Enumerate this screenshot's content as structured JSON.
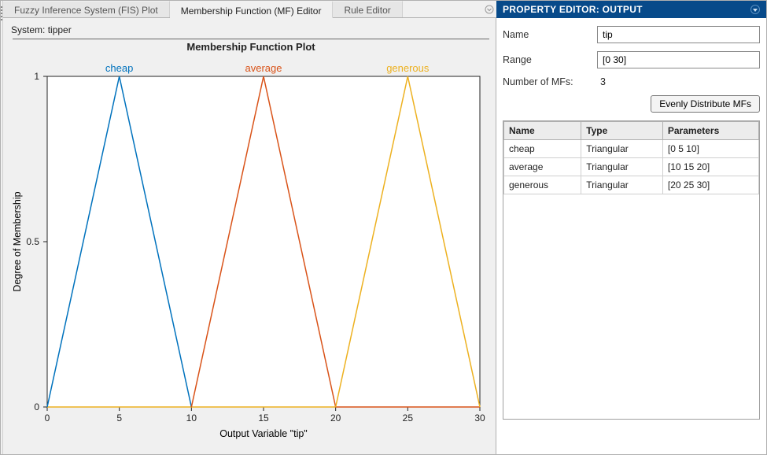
{
  "tabs": [
    {
      "label": "Fuzzy Inference System (FIS) Plot",
      "active": false
    },
    {
      "label": "Membership Function (MF) Editor",
      "active": true
    },
    {
      "label": "Rule Editor",
      "active": false
    }
  ],
  "system_label": "System:",
  "system_name": "tipper",
  "plot_title": "Membership Function Plot",
  "xlabel": "Output Variable \"tip\"",
  "ylabel": "Degree of Membership",
  "mf_labels": {
    "cheap": "cheap",
    "average": "average",
    "generous": "generous"
  },
  "x_ticks": [
    "0",
    "5",
    "10",
    "15",
    "20",
    "25",
    "30"
  ],
  "y_ticks": [
    "0",
    "0.5",
    "1"
  ],
  "colors": {
    "cheap": "#0072bd",
    "average": "#d95319",
    "generous": "#edb120"
  },
  "property_editor": {
    "title": "PROPERTY EDITOR: OUTPUT",
    "name_label": "Name",
    "name_value": "tip",
    "range_label": "Range",
    "range_value": "[0 30]",
    "num_mfs_label": "Number of MFs:",
    "num_mfs_value": "3",
    "distribute_btn": "Evenly Distribute MFs",
    "table_headers": {
      "name": "Name",
      "type": "Type",
      "params": "Parameters"
    },
    "rows": [
      {
        "name": "cheap",
        "type": "Triangular",
        "params": "[0 5 10]"
      },
      {
        "name": "average",
        "type": "Triangular",
        "params": "[10 15 20]"
      },
      {
        "name": "generous",
        "type": "Triangular",
        "params": "[20 25 30]"
      }
    ]
  },
  "chart_data": {
    "type": "line",
    "title": "Membership Function Plot",
    "xlabel": "Output Variable \"tip\"",
    "ylabel": "Degree of Membership",
    "xlim": [
      0,
      30
    ],
    "ylim": [
      0,
      1
    ],
    "x_ticks": [
      0,
      5,
      10,
      15,
      20,
      25,
      30
    ],
    "y_ticks": [
      0,
      0.5,
      1
    ],
    "series": [
      {
        "name": "cheap",
        "color": "#0072bd",
        "x": [
          0,
          5,
          10
        ],
        "y": [
          0,
          1,
          0
        ]
      },
      {
        "name": "average",
        "color": "#d95319",
        "x": [
          10,
          15,
          20
        ],
        "y": [
          0,
          1,
          0
        ]
      },
      {
        "name": "generous",
        "color": "#edb120",
        "x": [
          20,
          25,
          30
        ],
        "y": [
          0,
          1,
          0
        ]
      }
    ],
    "baseline": {
      "color_left": "#edb120",
      "color_mid": "#d95319",
      "color_right": "#d95319"
    }
  }
}
